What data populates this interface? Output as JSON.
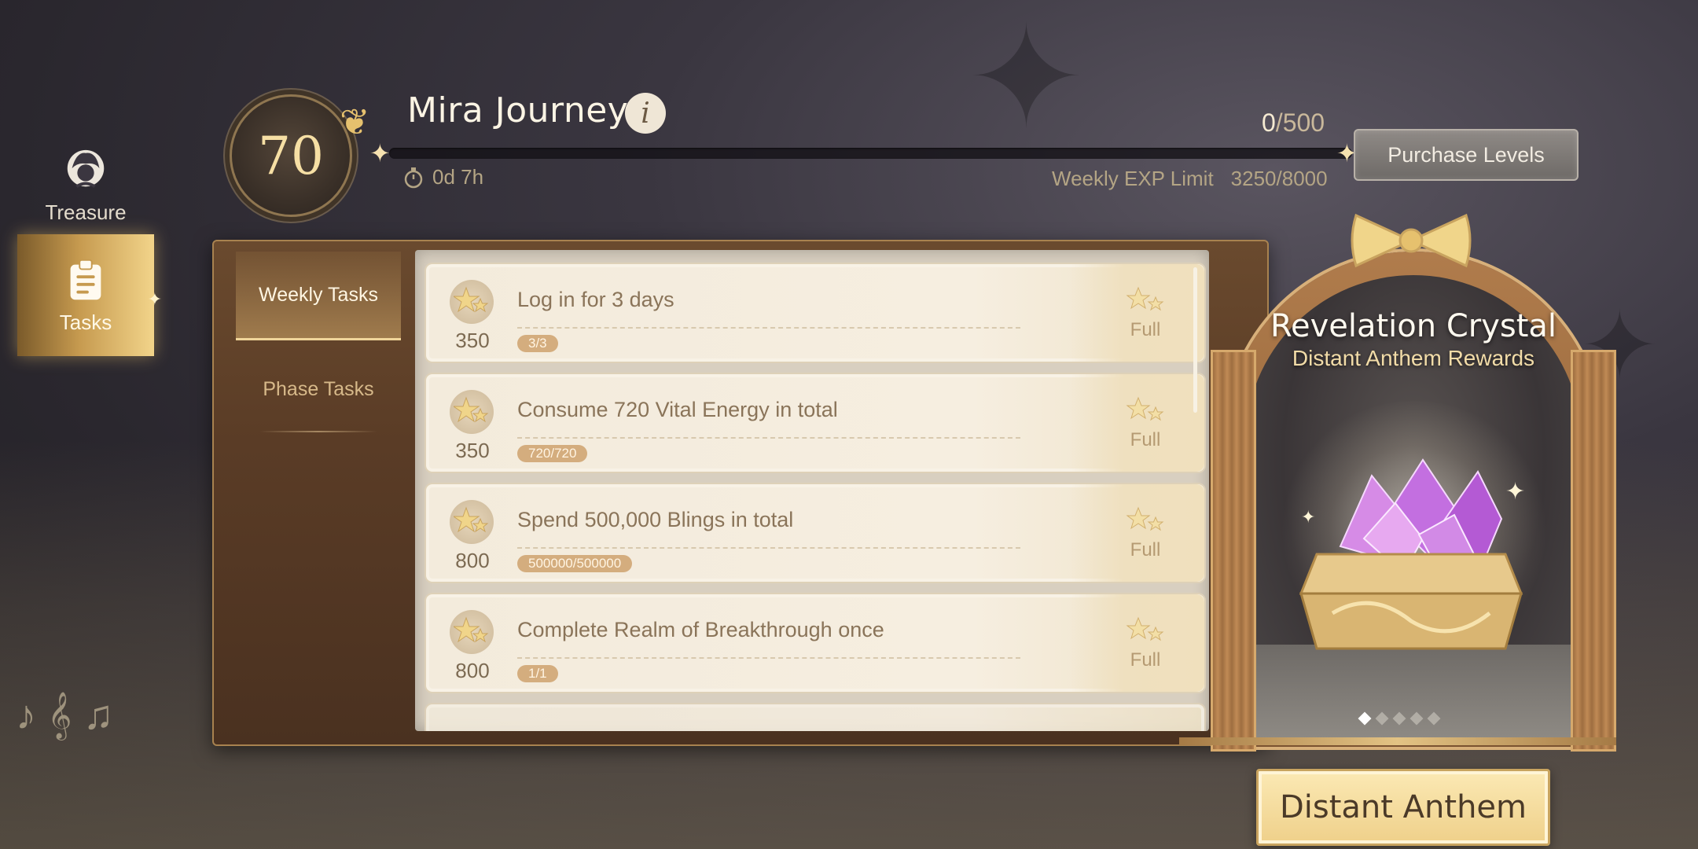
{
  "side_nav": {
    "items": [
      {
        "label": "Treasure",
        "active": false
      },
      {
        "label": "Tasks",
        "active": true
      }
    ]
  },
  "header": {
    "level": "70",
    "title": "Mira Journey",
    "info_glyph": "i",
    "exp_current": "0",
    "exp_max": "/500",
    "progress_fraction": 0,
    "timer": "0d 7h",
    "weekly_limit_label": "Weekly EXP Limit",
    "weekly_limit_value": "3250/8000",
    "purchase_label": "Purchase Levels"
  },
  "tabs": [
    {
      "label": "Weekly Tasks",
      "active": true
    },
    {
      "label": "Phase Tasks",
      "active": false
    }
  ],
  "tasks": [
    {
      "points": "350",
      "text": "Log in for 3 days",
      "progress": "3/3",
      "status": "Full"
    },
    {
      "points": "350",
      "text": "Consume 720 Vital Energy in total",
      "progress": "720/720",
      "status": "Full"
    },
    {
      "points": "800",
      "text": "Spend 500,000 Blings in total",
      "progress": "500000/500000",
      "status": "Full"
    },
    {
      "points": "800",
      "text": "Complete Realm of Breakthrough once",
      "progress": "1/1",
      "status": "Full"
    }
  ],
  "reward": {
    "title": "Revelation Crystal",
    "subtitle": "Distant Anthem Rewards",
    "page_count": 5,
    "active_page": 0
  },
  "anthem_button": "Distant Anthem",
  "colors": {
    "accent_gold": "#e8c47a",
    "panel_brown": "#5a3c26",
    "task_card": "#f3ebdc"
  },
  "icons": {
    "treasure": "treasure-avatar-icon",
    "tasks": "clipboard-icon",
    "timer": "stopwatch-icon",
    "star": "star-icon",
    "info": "info-icon"
  }
}
